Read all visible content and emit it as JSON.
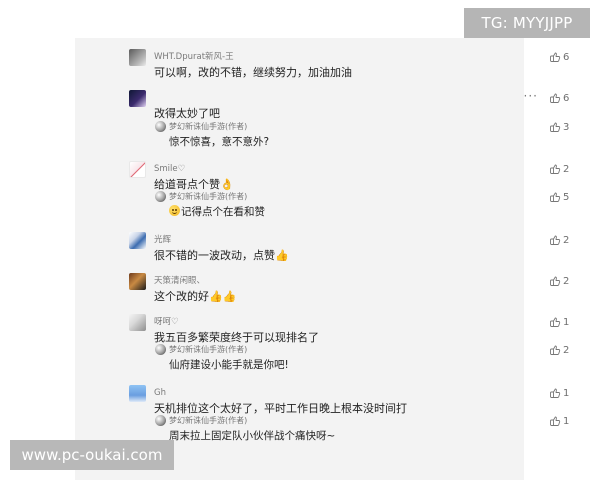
{
  "watermarks": {
    "telegram": "TG: MYYJJPP",
    "site": "www.pc-oukai.com"
  },
  "comments": [
    {
      "user": "WHT.Dpurat新风-王",
      "text": "可以啊，改的不错，继续努力，加油加油",
      "likes": "6",
      "avatar_icon": "avatar-gray-icon"
    },
    {
      "user": "",
      "text": "改得太妙了吧",
      "likes": "6",
      "more": "···",
      "avatar_icon": "avatar-purple-icon",
      "reply": {
        "user": "梦幻新诛仙手游(作者)",
        "text": "惊不惊喜，意不意外?",
        "likes": "3"
      }
    },
    {
      "user": "Smile♡",
      "text": "给道哥点个赞👌",
      "likes": "2",
      "avatar_icon": "avatar-white-red-icon",
      "reply": {
        "user": "梦幻新诛仙手游(作者)",
        "text": "记得点个在看和赞",
        "likes": "5"
      }
    },
    {
      "user": "光辉",
      "text": "很不错的一波改动，点赞👍",
      "likes": "2",
      "avatar_icon": "avatar-blue-icon"
    },
    {
      "user": "天策清闲眼、",
      "text": "这个改的好👍👍",
      "likes": "2",
      "avatar_icon": "avatar-brown-icon"
    },
    {
      "user": "呀呵♡",
      "text": "我五百多繁荣度终于可以现排名了",
      "likes": "1",
      "avatar_icon": "avatar-light-gray-icon",
      "reply": {
        "user": "梦幻新诛仙手游(作者)",
        "text": "仙府建设小能手就是你吧!",
        "likes": "2"
      }
    },
    {
      "user": "Gh",
      "text": "天机排位这个太好了，平时工作日晚上根本没时间打",
      "likes": "1",
      "avatar_icon": "avatar-sky-icon",
      "reply": {
        "user": "梦幻新诛仙手游(作者)",
        "text": "周末拉上固定队小伙伴战个痛快呀~",
        "likes": "1"
      }
    }
  ],
  "icons": {
    "like": "thumb-up-icon",
    "more": "more-options-icon",
    "reply_avatar": "author-avatar-icon"
  }
}
